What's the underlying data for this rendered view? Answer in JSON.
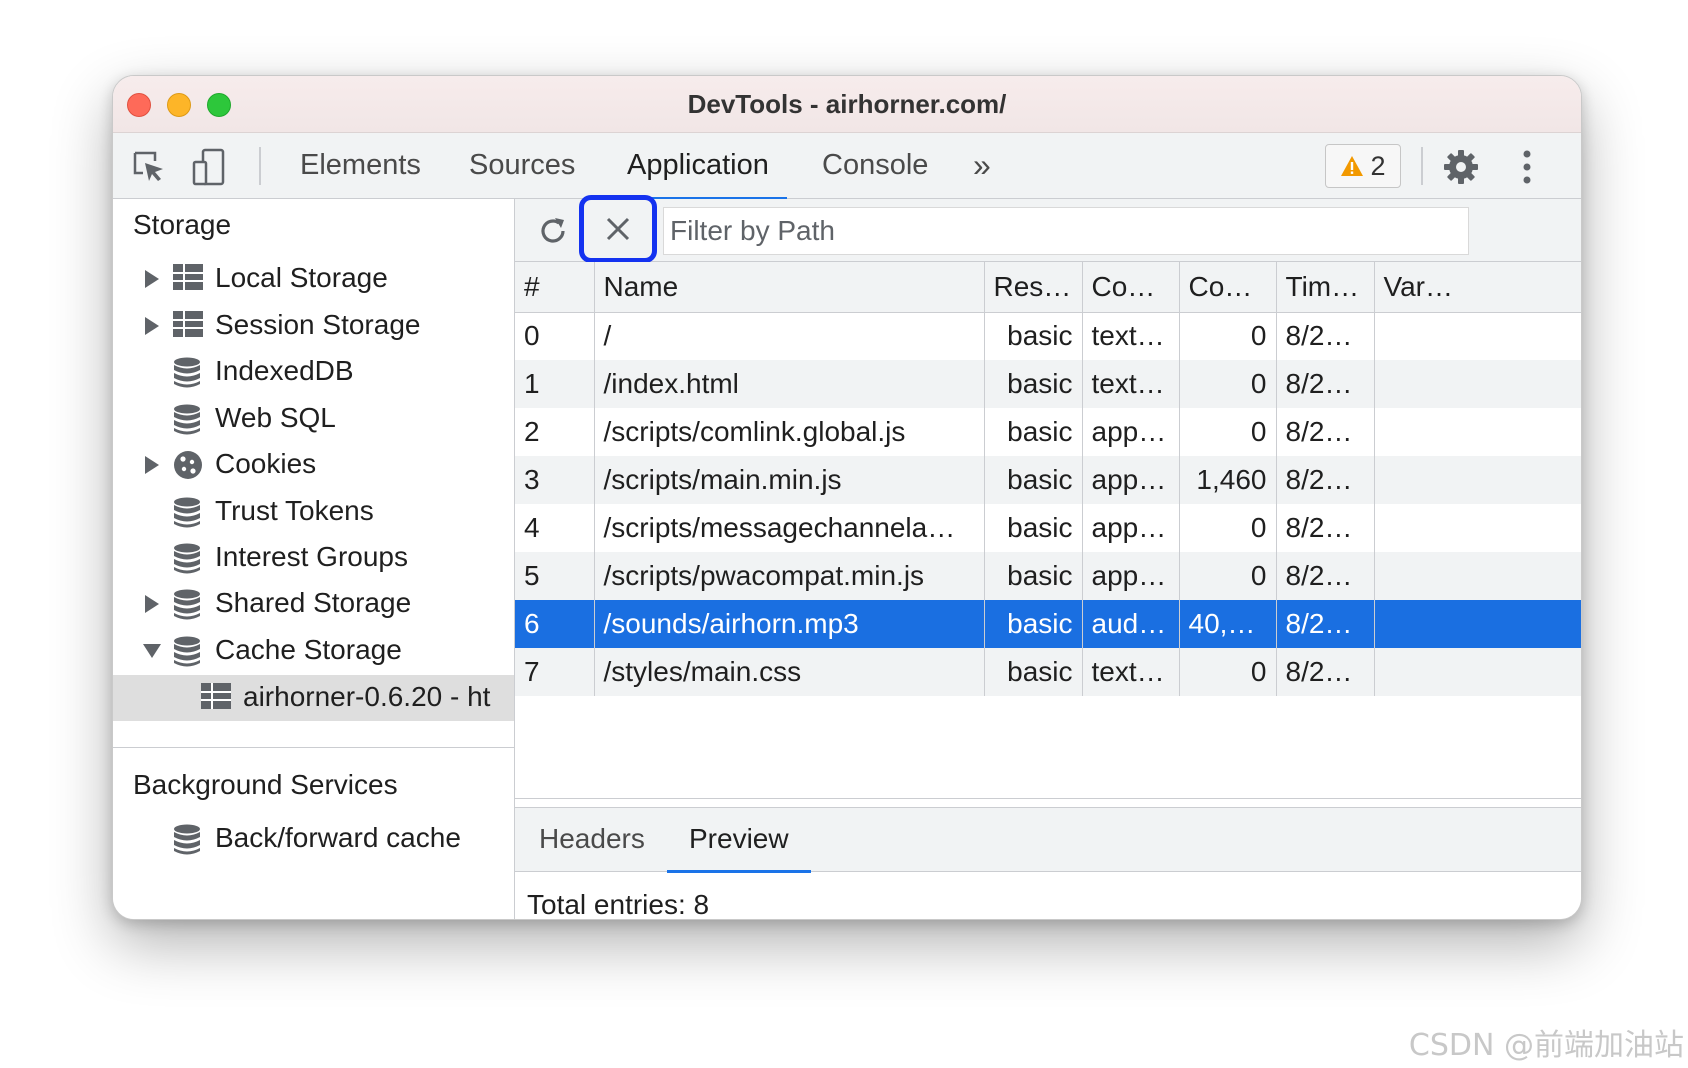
{
  "window": {
    "title": "DevTools - airhorner.com/"
  },
  "toolbar": {
    "inspect_icon": "inspect-element-icon",
    "device_icon": "device-toolbar-icon",
    "tabs": [
      {
        "label": "Elements"
      },
      {
        "label": "Sources"
      },
      {
        "label": "Application"
      },
      {
        "label": "Console"
      }
    ],
    "active_tab": "Application",
    "more_tabs": "»",
    "warnings": {
      "icon": "warning-icon",
      "count": "2"
    },
    "settings_icon": "gear-icon",
    "menu_icon": "kebab-menu-icon"
  },
  "sidebar": {
    "storage_heading": "Storage",
    "items": [
      {
        "label": "Local Storage",
        "icon": "table-icon",
        "expandable": true
      },
      {
        "label": "Session Storage",
        "icon": "table-icon",
        "expandable": true
      },
      {
        "label": "IndexedDB",
        "icon": "database-icon",
        "expandable": false
      },
      {
        "label": "Web SQL",
        "icon": "database-icon",
        "expandable": false
      },
      {
        "label": "Cookies",
        "icon": "cookie-icon",
        "expandable": true
      },
      {
        "label": "Trust Tokens",
        "icon": "database-icon",
        "expandable": false
      },
      {
        "label": "Interest Groups",
        "icon": "database-icon",
        "expandable": false
      },
      {
        "label": "Shared Storage",
        "icon": "database-icon",
        "expandable": true
      },
      {
        "label": "Cache Storage",
        "icon": "database-icon",
        "expandable": true,
        "expanded": true
      },
      {
        "label": "airhorner-0.6.20 - ht",
        "icon": "table-icon",
        "selected": true
      }
    ],
    "background_heading": "Background Services",
    "background_items": [
      {
        "label": "Back/forward cache",
        "icon": "database-icon"
      }
    ]
  },
  "filter": {
    "refresh_icon": "refresh-icon",
    "clear_icon": "clear-icon",
    "placeholder": "Filter by Path"
  },
  "table": {
    "columns": [
      "#",
      "Name",
      "Res…",
      "Co…",
      "Co…",
      "Tim…",
      "Var…"
    ],
    "rows": [
      {
        "idx": "0",
        "name": "/",
        "res": "basic",
        "type": "text…",
        "len": "0",
        "time": "8/2…",
        "vary": ""
      },
      {
        "idx": "1",
        "name": "/index.html",
        "res": "basic",
        "type": "text…",
        "len": "0",
        "time": "8/2…",
        "vary": ""
      },
      {
        "idx": "2",
        "name": "/scripts/comlink.global.js",
        "res": "basic",
        "type": "app…",
        "len": "0",
        "time": "8/2…",
        "vary": ""
      },
      {
        "idx": "3",
        "name": "/scripts/main.min.js",
        "res": "basic",
        "type": "app…",
        "len": "1,460",
        "time": "8/2…",
        "vary": ""
      },
      {
        "idx": "4",
        "name": "/scripts/messagechannela…",
        "res": "basic",
        "type": "app…",
        "len": "0",
        "time": "8/2…",
        "vary": ""
      },
      {
        "idx": "5",
        "name": "/scripts/pwacompat.min.js",
        "res": "basic",
        "type": "app…",
        "len": "0",
        "time": "8/2…",
        "vary": ""
      },
      {
        "idx": "6",
        "name": "/sounds/airhorn.mp3",
        "res": "basic",
        "type": "aud…",
        "len": "40,…",
        "time": "8/2…",
        "vary": "",
        "selected": true
      },
      {
        "idx": "7",
        "name": "/styles/main.css",
        "res": "basic",
        "type": "text…",
        "len": "0",
        "time": "8/2…",
        "vary": ""
      }
    ]
  },
  "bottom": {
    "tabs": [
      {
        "label": "Headers"
      },
      {
        "label": "Preview"
      }
    ],
    "active_tab": "Preview",
    "total_entries": "Total entries: 8"
  },
  "watermark": "CSDN @前端加油站",
  "colors": {
    "accent": "#1a73e8",
    "selected_row": "#1a6fe1",
    "highlight_box": "#1432f0",
    "warning": "#f29900"
  }
}
